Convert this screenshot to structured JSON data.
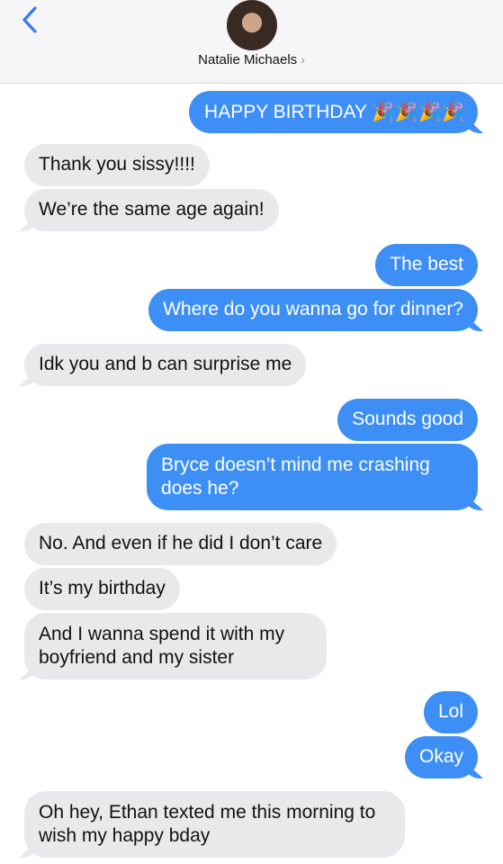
{
  "header": {
    "contact_name": "Natalie Michaels",
    "chevron": "›",
    "back_icon": "chevron-left-icon"
  },
  "colors": {
    "sent_bubble": "#3d8ff6",
    "received_bubble": "#e9e9eb",
    "accent": "#3478f6"
  },
  "messages": [
    {
      "from": "me",
      "text": "HAPPY BIRTHDAY",
      "emoji": "🎉🎉🎉🎉"
    },
    {
      "from": "them",
      "text": "Thank you sissy!!!!"
    },
    {
      "from": "them",
      "text": "We’re the same age again!"
    },
    {
      "from": "me",
      "text": "The best"
    },
    {
      "from": "me",
      "text": "Where do you wanna go for dinner?"
    },
    {
      "from": "them",
      "text": "Idk you and b can surprise me"
    },
    {
      "from": "me",
      "text": "Sounds good"
    },
    {
      "from": "me",
      "text": "Bryce doesn’t mind me crashing does he?"
    },
    {
      "from": "them",
      "text": "No. And even if he did I don’t care"
    },
    {
      "from": "them",
      "text": "It’s my birthday"
    },
    {
      "from": "them",
      "text": "And I wanna spend it with my boyfriend and my sister"
    },
    {
      "from": "me",
      "text": "Lol"
    },
    {
      "from": "me",
      "text": "Okay"
    },
    {
      "from": "them",
      "text": "Oh hey, Ethan texted me this morning to wish my happy bday"
    }
  ]
}
